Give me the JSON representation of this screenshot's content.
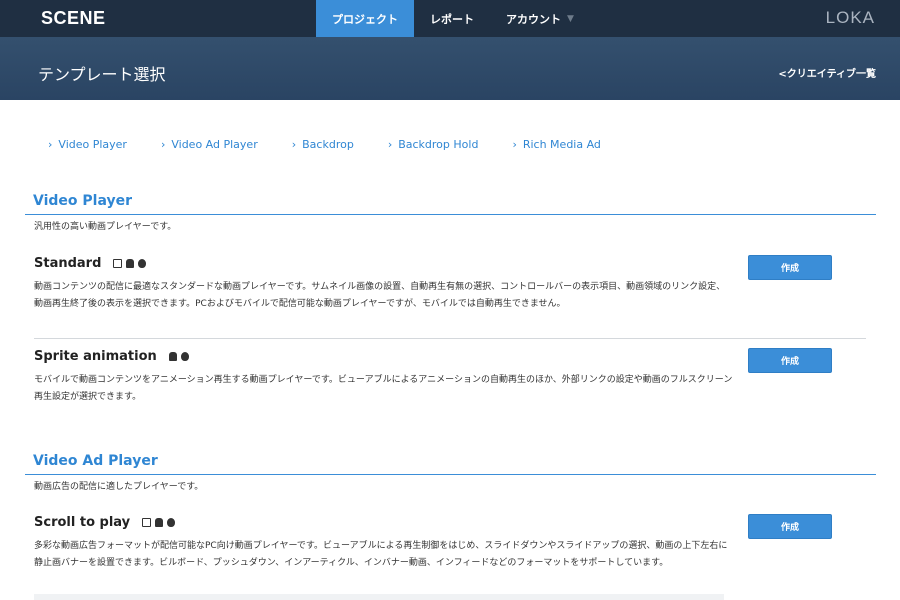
{
  "app": {
    "logo": "SCENE",
    "brand": "LOKA"
  },
  "nav": {
    "items": [
      {
        "label": "プロジェクト",
        "active": true
      },
      {
        "label": "レポート",
        "active": false
      },
      {
        "label": "アカウント",
        "active": false
      }
    ]
  },
  "header": {
    "title": "テンプレート選択",
    "back_link": "<クリエイティブ一覧"
  },
  "anchors": [
    "Video Player",
    "Video Ad Player",
    "Backdrop",
    "Backdrop Hold",
    "Rich Media Ad"
  ],
  "sections": [
    {
      "title": "Video Player",
      "description": "汎用性の高い動画プレイヤーです。",
      "cards": [
        {
          "title": "Standard",
          "platforms": [
            "tablet-icon",
            "android-icon",
            "apple-icon"
          ],
          "description": "動画コンテンツの配信に最適なスタンダードな動画プレイヤーです。サムネイル画像の設置、自動再生有無の選択、コントロールバーの表示項目、動画領域のリンク設定、動画再生終了後の表示を選択できます。PCおよびモバイルで配信可能な動画プレイヤーですが、モバイルでは自動再生できません。",
          "button": "作成"
        },
        {
          "title": "Sprite animation",
          "platforms": [
            "android-icon",
            "apple-icon"
          ],
          "description": "モバイルで動画コンテンツをアニメーション再生する動画プレイヤーです。ビューアブルによるアニメーションの自動再生のほか、外部リンクの設定や動画のフルスクリーン再生設定が選択できます。",
          "button": "作成"
        }
      ]
    },
    {
      "title": "Video Ad Player",
      "description": "動画広告の配信に適したプレイヤーです。",
      "cards": [
        {
          "title": "Scroll to play",
          "platforms": [
            "tablet-icon",
            "android-icon",
            "apple-icon"
          ],
          "description": "多彩な動画広告フォーマットが配信可能なPC向け動画プレイヤーです。ビューアブルによる再生制御をはじめ、スライドダウンやスライドアップの選択、動画の上下左右に静止画バナーを設置できます。ビルボード、プッシュダウン、インアーティクル、インバナー動画、インフィードなどのフォーマットをサポートしています。",
          "button": "作成"
        }
      ]
    }
  ],
  "colors": {
    "nav_bg": "#1f2f42",
    "accent": "#3b8ed8",
    "header_bg": "#2f4a68"
  }
}
